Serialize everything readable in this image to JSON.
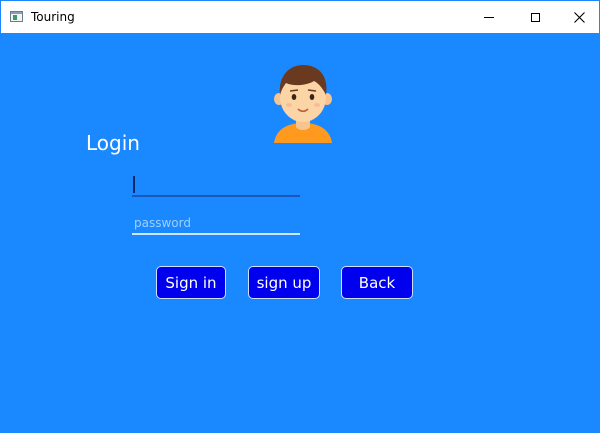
{
  "window": {
    "title": "Touring",
    "icons": {
      "app": "app-window-icon",
      "minimize": "minimize-icon",
      "maximize": "maximize-icon",
      "close": "close-icon"
    }
  },
  "main": {
    "heading": "Login",
    "avatar": "user-avatar-icon",
    "username": {
      "value": "",
      "placeholder": ""
    },
    "password": {
      "value": "",
      "placeholder": "password"
    }
  },
  "buttons": {
    "signin": "Sign in",
    "signup": "sign up",
    "back": "Back"
  },
  "colors": {
    "background": "#1a88ff",
    "button": "#0000ee",
    "text": "#ffffff"
  }
}
